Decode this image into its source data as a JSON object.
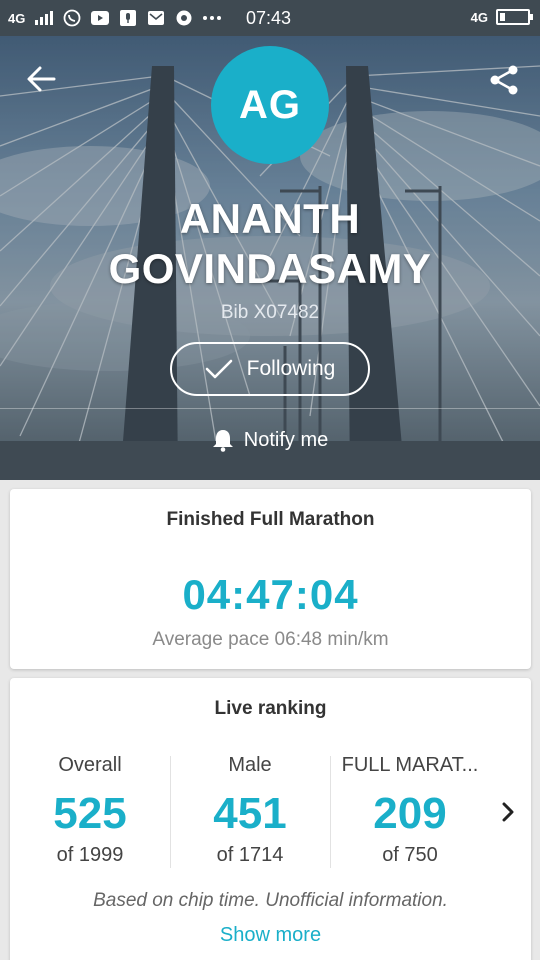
{
  "status_bar": {
    "network": "4G",
    "time": "07:43",
    "right_network": "4G"
  },
  "profile": {
    "initials": "AG",
    "name_line1": "ANANTH",
    "name_line2": "GOVINDASAMY",
    "bib": "Bib X07482",
    "follow_label": "Following",
    "notify_label": "Notify me"
  },
  "result": {
    "title": "Finished Full Marathon",
    "time": "04:47:04",
    "pace": "Average pace 06:48 min/km"
  },
  "ranking": {
    "title": "Live ranking",
    "items": [
      {
        "label": "Overall",
        "value": "525",
        "of": "of 1999"
      },
      {
        "label": "Male",
        "value": "451",
        "of": "of 1714"
      },
      {
        "label": "FULL MARAT...",
        "value": "209",
        "of": "of 750"
      }
    ],
    "disclaimer": "Based on chip time. Unofficial information.",
    "show_more": "Show more"
  },
  "colors": {
    "accent": "#1aafc9",
    "status_bar": "#3f4a52"
  },
  "icons": [
    "back-arrow-icon",
    "share-icon",
    "check-icon",
    "bell-icon",
    "chevron-right-icon",
    "whatsapp-icon",
    "youtube-icon",
    "microphone-icon",
    "mail-icon",
    "chrome-icon",
    "battery-icon"
  ]
}
